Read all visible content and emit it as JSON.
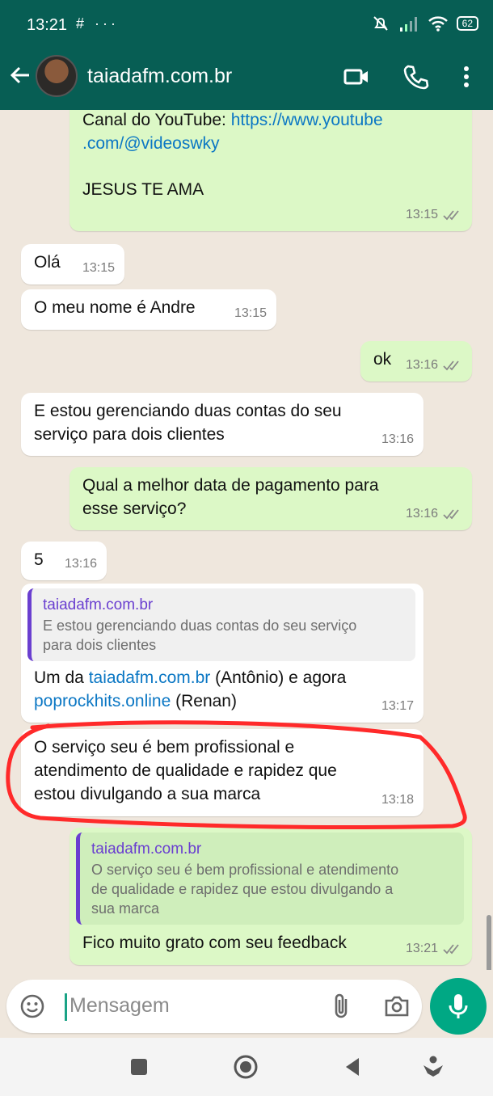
{
  "status_bar": {
    "time": "13:21",
    "left_icons": "# ···",
    "battery": "62"
  },
  "header": {
    "contact_name": "taiadafm.com.br"
  },
  "messages": [
    {
      "type": "out",
      "line1_prefix": "Canal do YouTube: ",
      "link1": "https://www.youtube",
      "link2": ".com/@videoswky",
      "line3": "JESUS TE AMA",
      "time": "13:15"
    },
    {
      "type": "in",
      "text": "Olá",
      "time": "13:15"
    },
    {
      "type": "in",
      "text": "O meu nome é Andre",
      "time": "13:15"
    },
    {
      "type": "out",
      "text": "ok",
      "time": "13:16"
    },
    {
      "type": "in",
      "line1": "E estou gerenciando duas contas do seu",
      "line2": "serviço para dois clientes",
      "time": "13:16"
    },
    {
      "type": "out",
      "line1": "Qual a melhor data de pagamento para",
      "line2": "esse serviço?",
      "time": "13:16"
    },
    {
      "type": "in",
      "text": "5",
      "time": "13:16"
    },
    {
      "type": "in",
      "quote_name": "taiadafm.com.br",
      "quote_line1": "E estou gerenciando duas contas do seu serviço",
      "quote_line2": "para dois clientes",
      "text_a": "Um da ",
      "link_a": "taiadafm.com.br",
      "text_b": " (Antônio) e agora",
      "link_b": "poprockhits.online",
      "text_c": " (Renan)",
      "time": "13:17"
    },
    {
      "type": "in",
      "line1": "O serviço seu é bem profissional e",
      "line2": "atendimento de qualidade e rapidez que",
      "line3": "estou divulgando a sua marca",
      "time": "13:18"
    },
    {
      "type": "out",
      "quote_name": "taiadafm.com.br",
      "quote_line1": "O serviço seu é bem profissional e atendimento",
      "quote_line2": "de qualidade e rapidez que estou divulgando a",
      "quote_line3": "sua marca",
      "text": "Fico muito grato com seu feedback",
      "time": "13:21"
    }
  ],
  "composer": {
    "placeholder": "Mensagem"
  },
  "colors": {
    "header": "#075e54",
    "outgoing": "#dcf8c6",
    "incoming": "#ffffff",
    "mic": "#00a884",
    "annotation": "#ff2a2a",
    "quote_bar": "#6a3fd0",
    "link": "#0b77c4"
  }
}
